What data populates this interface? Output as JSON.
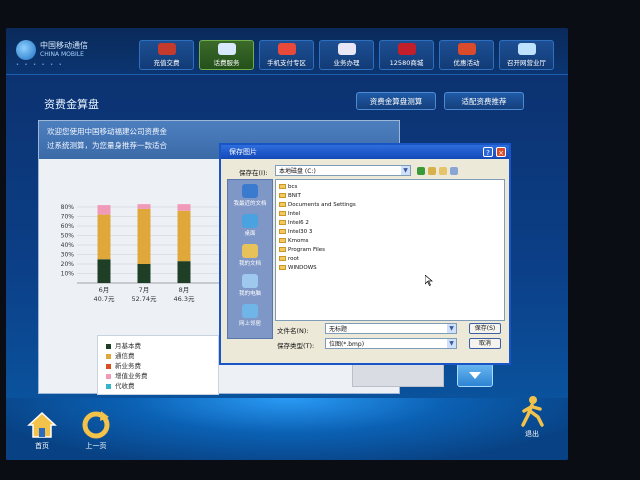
{
  "app": {
    "logo_cn": "中国移动通信",
    "logo_en": "CHINA MOBILE",
    "nav": [
      {
        "label": "充值交费",
        "icon": "gift-icon"
      },
      {
        "label": "话费服务",
        "icon": "phone-icon"
      },
      {
        "label": "手机支付专区",
        "icon": "pay-icon"
      },
      {
        "label": "业务办理",
        "icon": "house-icon"
      },
      {
        "label": "12580商城",
        "icon": "shop-icon"
      },
      {
        "label": "优惠活动",
        "icon": "promo-icon"
      },
      {
        "label": "召开网营业厅",
        "icon": "monitor-icon"
      }
    ],
    "active_nav_index": 1
  },
  "page": {
    "title": "资费金算盘",
    "btn_calc": "资费金算盘测算",
    "btn_recommend": "适配资费推荐",
    "welcome_line1": "欢迎您使用中国移动福建公司资费金",
    "welcome_line2": "过系统测算，为您量身推荐一款适合"
  },
  "chart_data": {
    "type": "bar",
    "stacked": true,
    "categories": [
      "6月",
      "7月",
      "8月"
    ],
    "totals_labels": [
      "40.7元",
      "52.74元",
      "46.3元"
    ],
    "y_ticks": [
      "10%",
      "20%",
      "30%",
      "40%",
      "50%",
      "60%",
      "70%",
      "80%"
    ],
    "series": [
      {
        "name": "月基本费",
        "values": [
          25,
          20,
          23
        ]
      },
      {
        "name": "通信费",
        "values": [
          47,
          58,
          53
        ]
      },
      {
        "name": "新业务费",
        "values": [
          0,
          0,
          0
        ]
      },
      {
        "name": "增值业务费",
        "values": [
          10,
          5,
          7
        ]
      },
      {
        "name": "代收费",
        "values": [
          0,
          0,
          0
        ]
      }
    ],
    "colors": [
      "#1e3f26",
      "#e0a73a",
      "#d8501e",
      "#f09ab8",
      "#35b5c8"
    ]
  },
  "dialog": {
    "title": "保存图片",
    "save_in_label": "保存在(I):",
    "save_in_value": "本地磁盘 (C:)",
    "places": [
      "我最近的文档",
      "桌面",
      "我的文档",
      "我的电脑",
      "网上邻居"
    ],
    "files": [
      "bcs",
      "BNIT",
      "Documents and Settings",
      "Intel",
      "Intel6 2",
      "Intel30 3",
      "Kmoms",
      "Program Files",
      "root",
      "WINDOWS"
    ],
    "filename_label": "文件名(N):",
    "filename_value": "无标题",
    "filetype_label": "保存类型(T):",
    "filetype_value": "位图(*.bmp)",
    "save_button": "保存(S)",
    "cancel_button": "取消",
    "help_button": "?",
    "close_button": "×"
  },
  "footer": {
    "home": "首页",
    "back": "上一页",
    "exit": "退出"
  }
}
